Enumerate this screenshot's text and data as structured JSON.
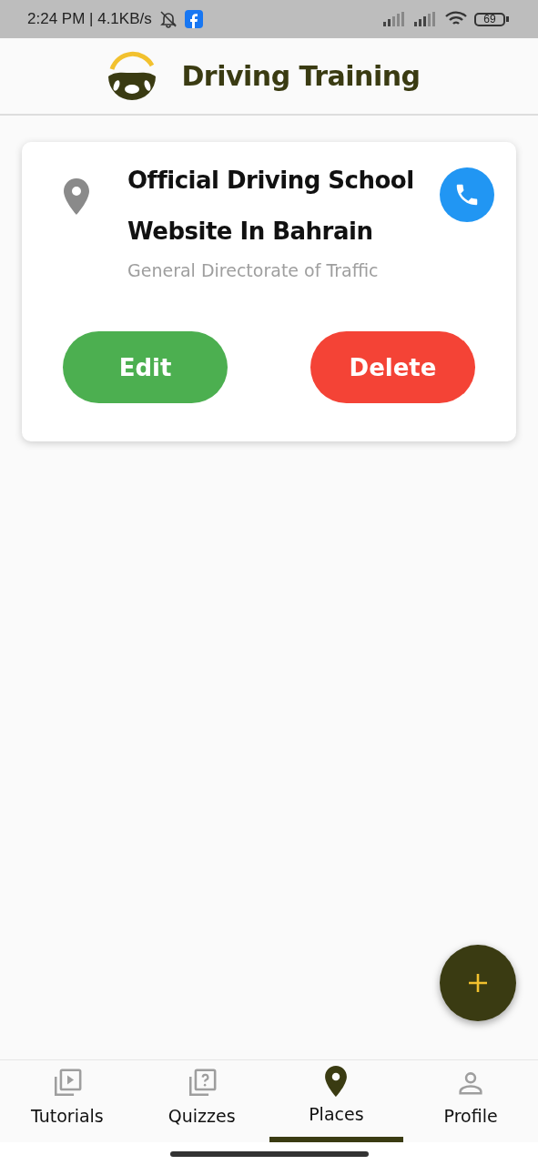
{
  "status_bar": {
    "time": "2:24 PM | 4.1KB/s",
    "battery": "69"
  },
  "header": {
    "title": "Driving Training"
  },
  "places": [
    {
      "title": "Official Driving School Website In Bahrain",
      "subtitle": "General Directorate of Traffic",
      "actions": [
        "Edit",
        "Delete"
      ]
    }
  ],
  "nav": [
    {
      "label": "Tutorials",
      "selected": false
    },
    {
      "label": "Quizzes",
      "selected": false
    },
    {
      "label": "Places",
      "selected": true
    },
    {
      "label": "Profile",
      "selected": false
    }
  ]
}
